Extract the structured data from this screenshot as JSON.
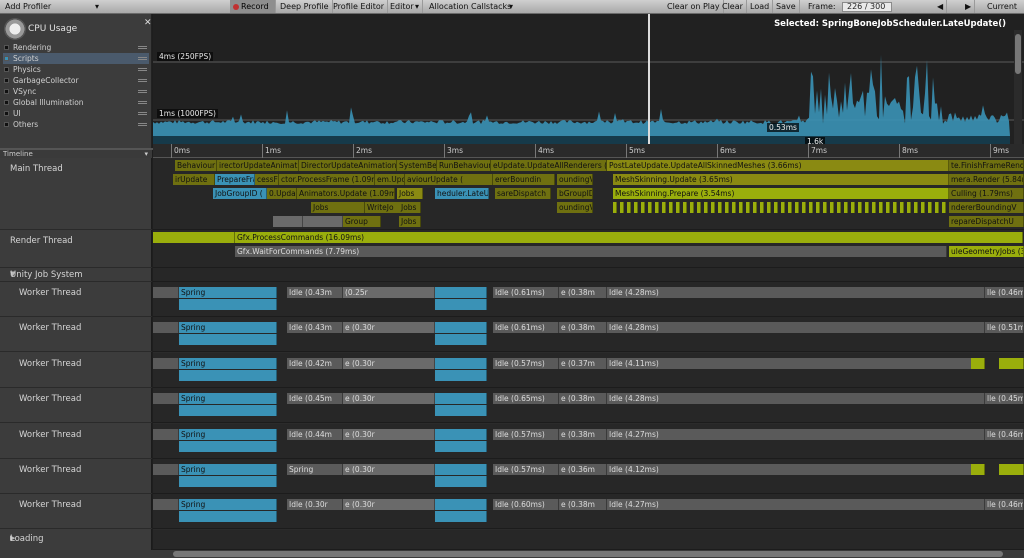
{
  "toolbar": {
    "add_profiler": "Add Profiler",
    "record": "Record",
    "deep_profile": "Deep Profile",
    "profile_editor": "Profile Editor",
    "editor": "Editor",
    "allocation_callstacks": "Allocation Callstacks",
    "clear_on_play": "Clear on Play",
    "clear": "Clear",
    "load": "Load",
    "save": "Save",
    "frame_label": "Frame:",
    "frame_value": "226 / 300",
    "prev": "◀",
    "next": "▶",
    "current": "Current"
  },
  "cpu": {
    "title": "CPU Usage",
    "legend": [
      {
        "label": "Rendering",
        "color": "#111111"
      },
      {
        "label": "Scripts",
        "color": "#3a92b6"
      },
      {
        "label": "Physics",
        "color": "#111111"
      },
      {
        "label": "GarbageCollector",
        "color": "#111111"
      },
      {
        "label": "VSync",
        "color": "#111111"
      },
      {
        "label": "Global Illumination",
        "color": "#111111"
      },
      {
        "label": "UI",
        "color": "#111111"
      },
      {
        "label": "Others",
        "color": "#111111"
      }
    ],
    "label_4ms": "4ms (250FPS)",
    "label_1ms": "1ms (1000FPS)",
    "selected": "Selected: SpringBoneJobScheduler.LateUpdate()",
    "value_a": "0.53ms",
    "value_b": "1.6k",
    "accent": "#3a92b6"
  },
  "timeline": {
    "header": "Timeline",
    "ticks": [
      "0ms",
      "1ms",
      "2ms",
      "3ms",
      "4ms",
      "5ms",
      "6ms",
      "7ms",
      "8ms",
      "9ms"
    ],
    "threads": {
      "main": "Main Thread",
      "render": "Render Thread",
      "job_system": "Unity Job System",
      "worker": "Worker Thread",
      "loading": "Loading"
    },
    "main_blocks": {
      "r0": [
        "Behaviour",
        "irectorUpdateAnimatio",
        "DirectorUpdateAnimation",
        "SystemBe",
        "RunBehaviour",
        "eUpdate.UpdateAllRenderers (",
        "PostLateUpdate.UpdateAllSkinnedMeshes (3.66ms)",
        "te.FinishFrameRende"
      ],
      "r1": [
        "irUpdate",
        "PrepareFrame",
        "cessFrame",
        "ctor.ProcessFrame (1.09m",
        "em.Upda",
        "aviourUpdate (",
        "ererBoundin",
        "oundingV",
        "MeshSkinning.Update (3.65ms)",
        "mera.Render (5.84m"
      ],
      "r2": [
        "JobGroupID (",
        "0.Updat",
        "Animators.Update (1.09ms)",
        "Jobs",
        "heduler.LateU",
        "sareDispatch",
        "bGroupID",
        "MeshSkinning.Prepare (3.54ms)",
        "Culling (1.79ms)"
      ],
      "r3": [
        "Jobs",
        "WriteJo",
        "Jobs",
        "oundingV",
        "ndererBoundingV"
      ],
      "r4": [
        "Jobs",
        "Group",
        "Jobs",
        "repareDispatchU"
      ]
    },
    "render_blocks": [
      "Gfx.ProcessCommands (16.09ms)",
      "Gfx.WaitForCommands (7.79ms)",
      "uleGeometryJobs (3."
    ],
    "workers": [
      {
        "a": "Spring",
        "b": "Idle (0.43m",
        "c": "(0.25r",
        "d": "Idle (0.61ms)",
        "e": "e (0.38m",
        "f": "Idle (4.28ms)",
        "g": "lle (0.46m"
      },
      {
        "a": "Spring",
        "b": "Idle (0.43m",
        "c": "e (0.30r",
        "d": "Idle (0.61ms)",
        "e": "e (0.38m",
        "f": "Idle (4.28ms)",
        "g": "lle (0.51m"
      },
      {
        "a": "Spring",
        "b": "Idle (0.42m",
        "c": "e (0.30r",
        "d": "Idle (0.57ms)",
        "e": "e (0.37m",
        "f": "Idle (4.11ms)",
        "g": ""
      },
      {
        "a": "Spring",
        "b": "Idle (0.45m",
        "c": "e (0.30r",
        "d": "Idle (0.65ms)",
        "e": "e (0.38m",
        "f": "Idle (4.28ms)",
        "g": "lle (0.45m"
      },
      {
        "a": "Spring",
        "b": "Idle (0.44m",
        "c": "e (0.30r",
        "d": "Idle (0.57ms)",
        "e": "e (0.38m",
        "f": "Idle (4.27ms)",
        "g": "lle (0.46m"
      },
      {
        "a": "Spring",
        "b": "Spring",
        "c": "e (0.30r",
        "d": "Idle (0.57ms)",
        "e": "e (0.36m",
        "f": "Idle (4.12ms)",
        "g": ""
      },
      {
        "a": "Spring",
        "b": "Idle (0.30r",
        "c": "e (0.30r",
        "d": "Idle (0.60ms)",
        "e": "e (0.38m",
        "f": "Idle (4.27ms)",
        "g": "lle (0.46m"
      }
    ]
  }
}
